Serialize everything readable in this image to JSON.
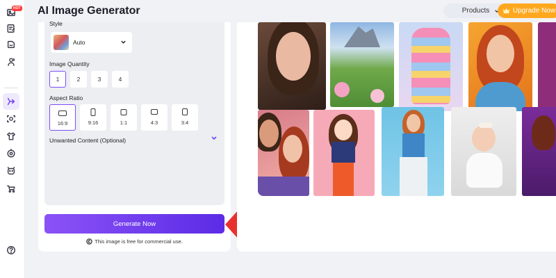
{
  "header": {
    "title": "AI Image Generator",
    "products_label": "Products",
    "upgrade_label": "Upgrade Now"
  },
  "rail": {
    "hot_badge": "HOT"
  },
  "form": {
    "style_label": "Style",
    "style_value": "Auto",
    "quantity_label": "Image Quantity",
    "quantity_options": [
      "1",
      "2",
      "3",
      "4"
    ],
    "quantity_selected": "1",
    "ratio_label": "Aspect Ratio",
    "ratio_options": [
      "16:9",
      "9:16",
      "1:1",
      "4:3",
      "3:4"
    ],
    "ratio_selected": "16:9",
    "unwanted_label": "Unwanted Content (Optional)"
  },
  "actions": {
    "generate_label": "Generate Now",
    "free_note": "This image is free for commercial use."
  },
  "colors": {
    "accent": "#7c4df5",
    "upgrade": "#ffa81f",
    "pointer_arrow": "#e8312f"
  }
}
